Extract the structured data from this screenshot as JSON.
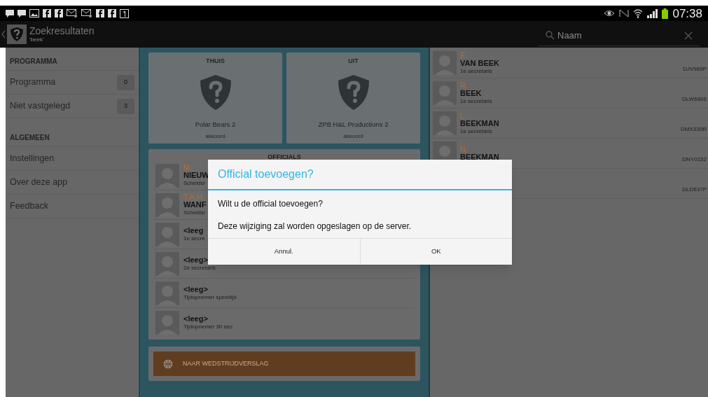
{
  "status_bar": {
    "time": "07:38"
  },
  "action_bar": {
    "title": "Zoekresultaten",
    "subtitle": "'beek'",
    "search": {
      "placeholder": "Naam"
    }
  },
  "sidebar": {
    "sections": [
      {
        "heading": "PROGRAMMA",
        "items": [
          {
            "label": "Programma",
            "count": "0"
          },
          {
            "label": "Niet vastgelegd",
            "count": "3"
          }
        ]
      },
      {
        "heading": "ALGEMEEN",
        "items": [
          {
            "label": "Instellingen"
          },
          {
            "label": "Over deze app"
          },
          {
            "label": "Feedback"
          }
        ]
      }
    ]
  },
  "match": {
    "teams": [
      {
        "side": "THUIS",
        "name": "Polar Bears 2",
        "status": "akkoord"
      },
      {
        "side": "UIT",
        "name": "ZPB H&L Productions 2",
        "status": "akkoord"
      }
    ]
  },
  "officials": {
    "heading": "OFFICIALS",
    "rows": [
      {
        "initials": "M.",
        "name": "NIEUW",
        "role": "Scheidsr"
      },
      {
        "initials": "T.A.H",
        "name": "WANF",
        "role": "Scheidsr"
      },
      {
        "name": "<leeg",
        "role": "1e secre"
      },
      {
        "name": "<leeg>",
        "role": "2e secretaris"
      },
      {
        "name": "<leeg>",
        "role": "Tijdopnemer speeltijd"
      },
      {
        "name": "<leeg>",
        "role": "Tijdopnemer 30 sec"
      }
    ]
  },
  "action_button": "NAAR WEDSTRIJDVERSLAG",
  "results": [
    {
      "initials": "E.",
      "name": "VAN BEEK",
      "role": "1e secretaris",
      "code": "DJV989P"
    },
    {
      "initials": "R.",
      "name": "BEEK",
      "role": "1e secretaris",
      "code": "DLW6806"
    },
    {
      "initials": "L.",
      "name": "BEEKMAN",
      "role": "1e secretaris",
      "code": "DMX339R"
    },
    {
      "initials": "N.",
      "name": "BEEKMAN",
      "code": "DNY0152"
    },
    {
      "code": "DLD637P"
    }
  ],
  "dialog": {
    "title": "Official toevoegen?",
    "message": "Wilt u de official toevoegen?",
    "note": "Deze wijziging zal worden opgeslagen op de server.",
    "buttons": [
      "Annul.",
      "OK"
    ]
  }
}
